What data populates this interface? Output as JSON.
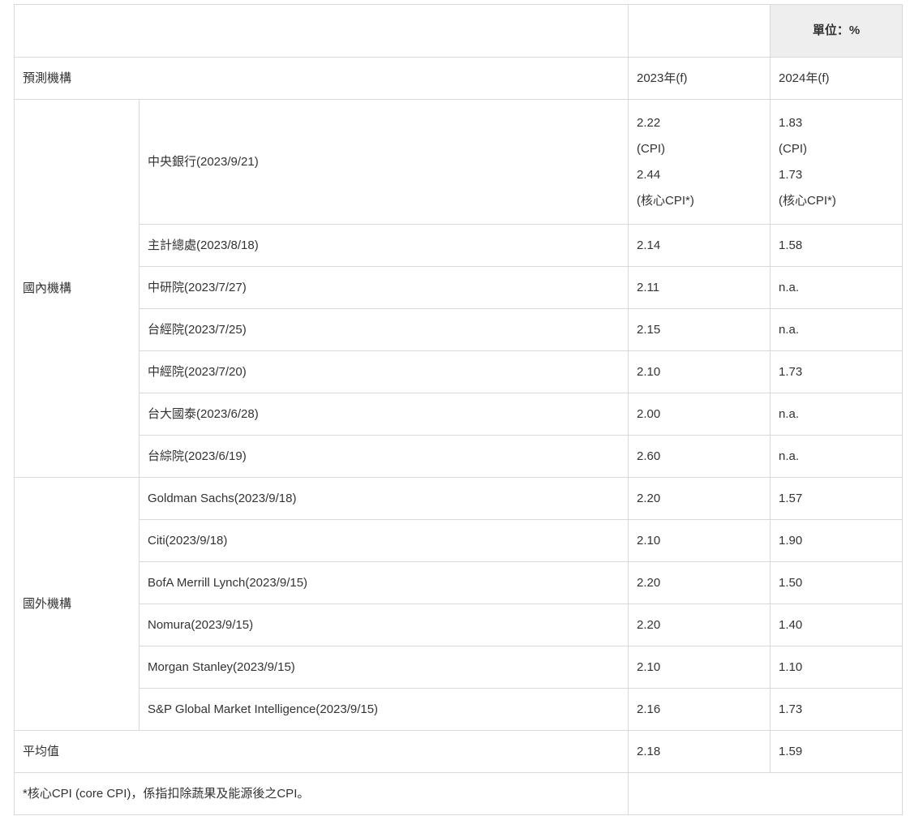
{
  "header": {
    "unit_label": "單位：%"
  },
  "columns": {
    "institution": "預測機構",
    "y2023": "2023年(f)",
    "y2024": "2024年(f)"
  },
  "groups": {
    "domestic": "國內機構",
    "foreign": "國外機構"
  },
  "cbc": {
    "name": "中央銀行(2023/9/21)",
    "v2023": [
      "2.22",
      "(CPI)",
      "2.44",
      "(核心CPI*)"
    ],
    "v2024": [
      "1.83",
      "(CPI)",
      "1.73",
      "(核心CPI*)"
    ]
  },
  "domestic_rows": [
    {
      "name": "主計總處(2023/8/18)",
      "v2023": "2.14",
      "v2024": "1.58"
    },
    {
      "name": "中研院(2023/7/27)",
      "v2023": "2.11",
      "v2024": "n.a."
    },
    {
      "name": "台經院(2023/7/25)",
      "v2023": "2.15",
      "v2024": "n.a."
    },
    {
      "name": "中經院(2023/7/20)",
      "v2023": "2.10",
      "v2024": "1.73"
    },
    {
      "name": "台大國泰(2023/6/28)",
      "v2023": "2.00",
      "v2024": "n.a."
    },
    {
      "name": "台綜院(2023/6/19)",
      "v2023": "2.60",
      "v2024": "n.a."
    }
  ],
  "foreign_rows": [
    {
      "name": "Goldman Sachs(2023/9/18)",
      "v2023": "2.20",
      "v2024": "1.57"
    },
    {
      "name": "Citi(2023/9/18)",
      "v2023": "2.10",
      "v2024": "1.90"
    },
    {
      "name": "BofA Merrill Lynch(2023/9/15)",
      "v2023": "2.20",
      "v2024": "1.50"
    },
    {
      "name": "Nomura(2023/9/15)",
      "v2023": "2.20",
      "v2024": "1.40"
    },
    {
      "name": "Morgan Stanley(2023/9/15)",
      "v2023": "2.10",
      "v2024": "1.10"
    },
    {
      "name": "S&P Global Market Intelligence(2023/9/15)",
      "v2023": "2.16",
      "v2024": "1.73"
    }
  ],
  "average": {
    "label": "平均值",
    "v2023": "2.18",
    "v2024": "1.59"
  },
  "footnote": "*核心CPI (core CPI)，係指扣除蔬果及能源後之CPI。"
}
